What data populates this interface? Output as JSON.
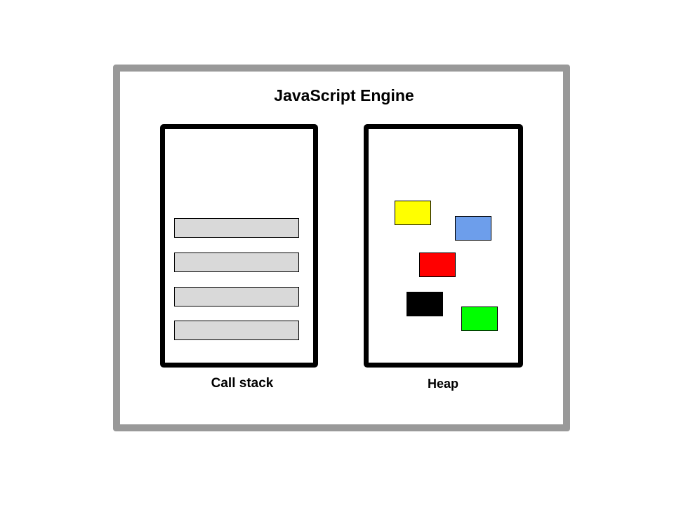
{
  "diagram": {
    "title": "JavaScript Engine",
    "call_stack": {
      "label": "Call stack",
      "frame_count": 4,
      "frame_color": "#d9d9d9"
    },
    "heap": {
      "label": "Heap",
      "objects": [
        {
          "color": "#ffff00"
        },
        {
          "color": "#6d9eeb"
        },
        {
          "color": "#ff0000"
        },
        {
          "color": "#000000"
        },
        {
          "color": "#00ff00"
        }
      ]
    },
    "frame_color": "#999999"
  }
}
